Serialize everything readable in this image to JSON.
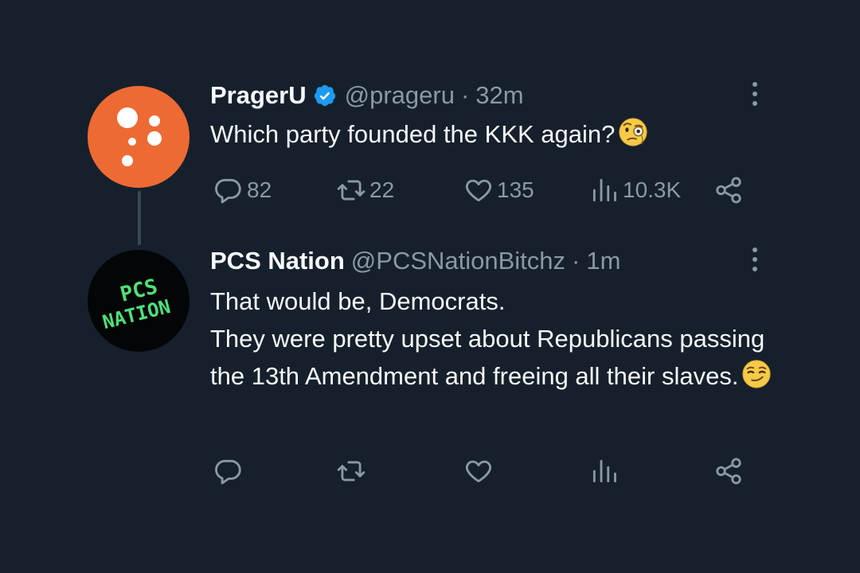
{
  "tweets": [
    {
      "name": "PragerU",
      "verified": true,
      "handle": "@prageru",
      "separator": "·",
      "time": "32m",
      "text_lines": [
        "Which party founded the KKK again?"
      ],
      "emoji": "face-with-monocle",
      "stats": {
        "replies": "82",
        "retweets": "22",
        "likes": "135",
        "views": "10.3K"
      },
      "avatar_color": "#ee6a33"
    },
    {
      "name": "PCS Nation",
      "verified": false,
      "handle": "@PCSNationBitchz",
      "separator": "·",
      "time": "1m",
      "text_lines": [
        "That would be, Democrats.",
        "They were pretty upset about Republicans passing the 13th Amendment and freeing all their slaves."
      ],
      "emoji": "smirking-face",
      "avatar_text": {
        "top": "PCS",
        "bottom": "NATION"
      },
      "avatar_color": "#040507"
    }
  ],
  "colors": {
    "background": "#16202c",
    "text": "#f7f9f9",
    "muted": "#8b98a5",
    "verified": "#1d9bf0",
    "accent_green": "#4ee07a"
  }
}
